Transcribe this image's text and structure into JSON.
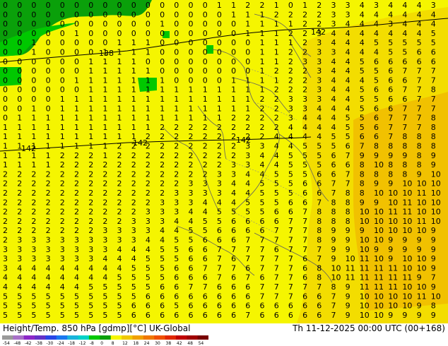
{
  "footer": {
    "left_title": "Height/Temp. 850 hPa [gdmp][°C] UK-Global",
    "right_title": "Th 11-12-2025 00:00 UTC (00+168)"
  },
  "map": {
    "contour_labels": [
      {
        "text": "138",
        "key": "c1"
      },
      {
        "text": "142",
        "key": "c2"
      },
      {
        "text": "142",
        "key": "c3"
      },
      {
        "text": "142",
        "key": "c4"
      },
      {
        "text": "142",
        "key": "c5"
      },
      {
        "text": "142",
        "key": "c6"
      },
      {
        "text": "138",
        "key": "c7"
      }
    ]
  },
  "colorbar": {
    "ticks": [
      "-54",
      "-48",
      "-42",
      "-38",
      "-30",
      "-24",
      "-18",
      "-12",
      "-8",
      "0",
      "8",
      "12",
      "18",
      "24",
      "30",
      "38",
      "42",
      "48",
      "54"
    ],
    "colors": [
      "#9a9a9a",
      "#a870c8",
      "#8c28c8",
      "#6432c8",
      "#2846e6",
      "#1a78f0",
      "#1ab4dc",
      "#00d2c8",
      "#00c800",
      "#0aa00a",
      "#f5f500",
      "#f0c800",
      "#f0a000",
      "#f07800",
      "#f05000",
      "#e02800",
      "#c00000",
      "#a00000",
      "#780000"
    ]
  },
  "grid_digits": {
    "rows": [
      "0 0 0 0 0 0 0 0 0 0 0 0 0 0 0 1 1 2 2 1 0 1 2 3 3 4 3 4 4 4 3",
      "0 0 0 0 0 0 0 0 0 0 0 0 0 0 0 0 1 1 1 2 2 2 2 3 3 4 4 4 4 4 4",
      "0 0 0 0 0 0 0 0 0 0 0 1 0 0 0 0 0 1 1 1 1 2 2 3 4 4 4 3 4 4 4",
      "0 0 0 0 0 1 0 0 0 0 0 0 0 0 0 0 0 1 1 1 2 2 3 4 4 4 4 4 4 4 5",
      "0 0 1 0 0 0 0 0 1 1 1 0 0 0 0 0 0 0 1 1 1 2 3 4 4 4 5 5 5 5 5",
      "0 0 1 0 0 0 0 1 1 1 1 0 0 0 0 0 0 0 1 1 2 2 3 3 4 4 4 5 5 6 6",
      "0 0 0 0 0 0 1 1 1 1 0 0 0 0 0 0 0 0 1 1 2 3 3 4 4 5 6 6 6 6 6",
      "0 0 0 0 0 0 1 1 1 1 1 0 0 0 0 0 0 0 1 2 2 2 3 4 4 5 5 6 7 7 7",
      "0 0 0 0 0 1 1 1 1 1 1 1 0 0 0 0 1 1 1 1 2 2 3 4 4 4 5 6 6 7 7",
      "0 0 0 0 0 0 1 1 1 1 1 1 1 1 1 1 1 1 1 2 2 2 3 4 4 5 6 6 7 7 8",
      "0 0 0 0 1 1 1 1 1 1 1 1 1 1 1 1 1 1 2 2 3 3 3 4 4 5 5 6 6 7 7",
      "0 0 1 0 1 1 1 1 1 1 1 1 1 1 1 1 1 1 2 2 3 3 4 4 4 5 6 6 7 7 7",
      "0 1 1 1 1 1 1 1 1 1 1 1 1 1 1 1 2 2 2 2 3 4 4 4 5 5 6 7 7 7 8",
      "1 1 1 1 1 1 1 1 1 1 1 2 2 2 2 2 2 2 2 2 4 4 4 4 5 5 6 7 7 7 8",
      "1 1 1 1 1 1 1 1 1 1 2 2 2 2 2 2 2 2 2 4 4 4 4 5 5 6 6 7 8 8 8",
      "1 1 1 1 1 1 1 1 2 2 2 2 2 2 2 2 2 3 3 4 4 5 5 5 6 7 8 8 8 8 8",
      "1 1 1 1 2 2 2 1 2 2 2 2 2 2 2 2 2 3 4 4 5 5 5 6 7 9 9 9 9 8 9",
      "1 1 1 1 2 2 2 2 2 2 2 2 2 2 2 2 3 3 4 4 5 5 5 6 6 8 10 8 8 8 9",
      "2 2 2 2 2 2 2 2 2 2 2 2 2 2 2 3 3 4 4 5 5 5 6 6 7 8 8 8 8 9 10",
      "2 2 2 2 2 2 2 2 2 2 2 2 2 3 3 3 4 4 5 5 5 6 6 7 7 8 9 9 10 10 10",
      "2 2 2 2 2 2 2 2 2 2 2 2 3 3 3 3 4 4 5 5 5 6 6 7 8 8 10 10 10 11 10",
      "2 2 2 2 2 2 2 2 2 2 2 3 3 3 4 4 4 5 5 5 6 6 7 8 8 9 9 10 11 10 10",
      "2 2 2 2 2 2 2 2 2 2 3 3 3 4 4 5 5 5 5 6 6 7 8 8 8 10 10 11 11 10 10",
      "2 2 2 2 2 2 2 2 2 3 3 3 4 4 5 5 6 6 6 6 7 7 8 8 8 10 10 10 10 11 10",
      "2 2 2 2 2 2 2 3 3 3 3 4 4 5 5 6 6 6 6 7 7 7 8 9 9 9 10 10 10 10 9",
      "2 3 3 3 3 3 3 3 3 3 4 4 5 5 6 6 6 7 7 7 7 7 8 9 9 10 10 9 9 9 9",
      "3 3 3 3 3 3 3 3 4 4 4 5 5 6 6 7 7 7 7 6 7 7 7 9 9 10 9 9 9 9 9",
      "3 3 3 3 3 3 3 4 4 4 5 5 5 6 6 7 6 7 7 7 7 6 7 9 10 11 10 9 10 10 9",
      "3 4 4 4 4 4 4 4 4 5 5 5 6 6 7 7 7 6 7 7 7 6 8 10 11 11 11 11 10 10 9",
      "4 4 4 4 4 4 4 4 5 5 5 5 6 6 6 7 6 7 6 7 7 6 8 10 11 11 11 11 11 9 7",
      "4 4 4 4 4 4 5 5 5 5 5 6 6 7 7 6 6 6 7 7 7 7 7 8 9 11 11 11 10 10 9",
      "5 5 5 5 5 5 5 5 5 5 6 6 6 6 6 6 6 6 7 7 7 6 6 7 9 10 10 10 10 11 10",
      "5 5 5 5 5 5 5 5 5 6 6 6 5 6 6 6 6 6 6 6 6 6 6 7 9 10 10 10 10 9 8",
      "5 5 5 5 5 5 5 5 5 6 6 6 6 6 6 6 6 7 6 6 6 6 6 7 9 10 10 9 9 9 9"
    ]
  }
}
